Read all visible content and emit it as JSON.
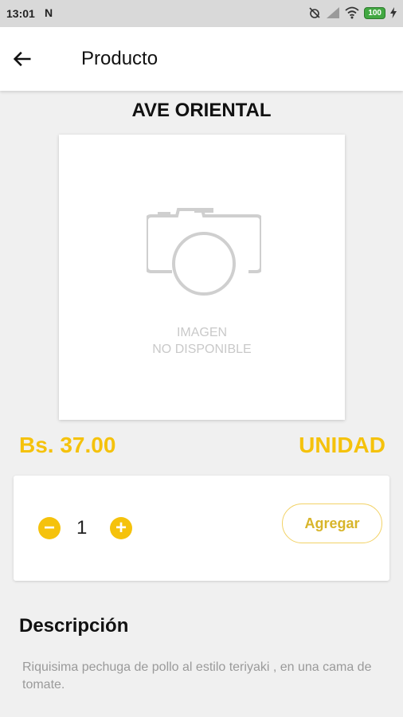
{
  "status_bar": {
    "time": "13:01",
    "notification_letter": "N",
    "battery": "100",
    "icons": [
      "notification-n-icon",
      "alarm-off-icon",
      "signal-icon",
      "wifi-icon",
      "battery-icon",
      "charging-icon"
    ]
  },
  "app_bar": {
    "title": "Producto",
    "back_icon": "arrow-left-icon"
  },
  "product": {
    "name": "AVE ORIENTAL",
    "image_placeholder_line1": "IMAGEN",
    "image_placeholder_line2": "NO DISPONIBLE",
    "image_icon": "camera-icon",
    "price": "Bs. 37.00",
    "unit": "UNIDAD"
  },
  "quantity": {
    "minus_label": "−",
    "value": "1",
    "plus_label": "+",
    "add_label": "Agregar"
  },
  "description": {
    "title": "Descripción",
    "text": "Riquisima  pechuga de pollo al estilo teriyaki , en una cama de tomate."
  },
  "colors": {
    "accent": "#f5c20c",
    "background": "#f0f0f0",
    "status_bar": "#d9d9d9",
    "battery": "#42a842"
  }
}
